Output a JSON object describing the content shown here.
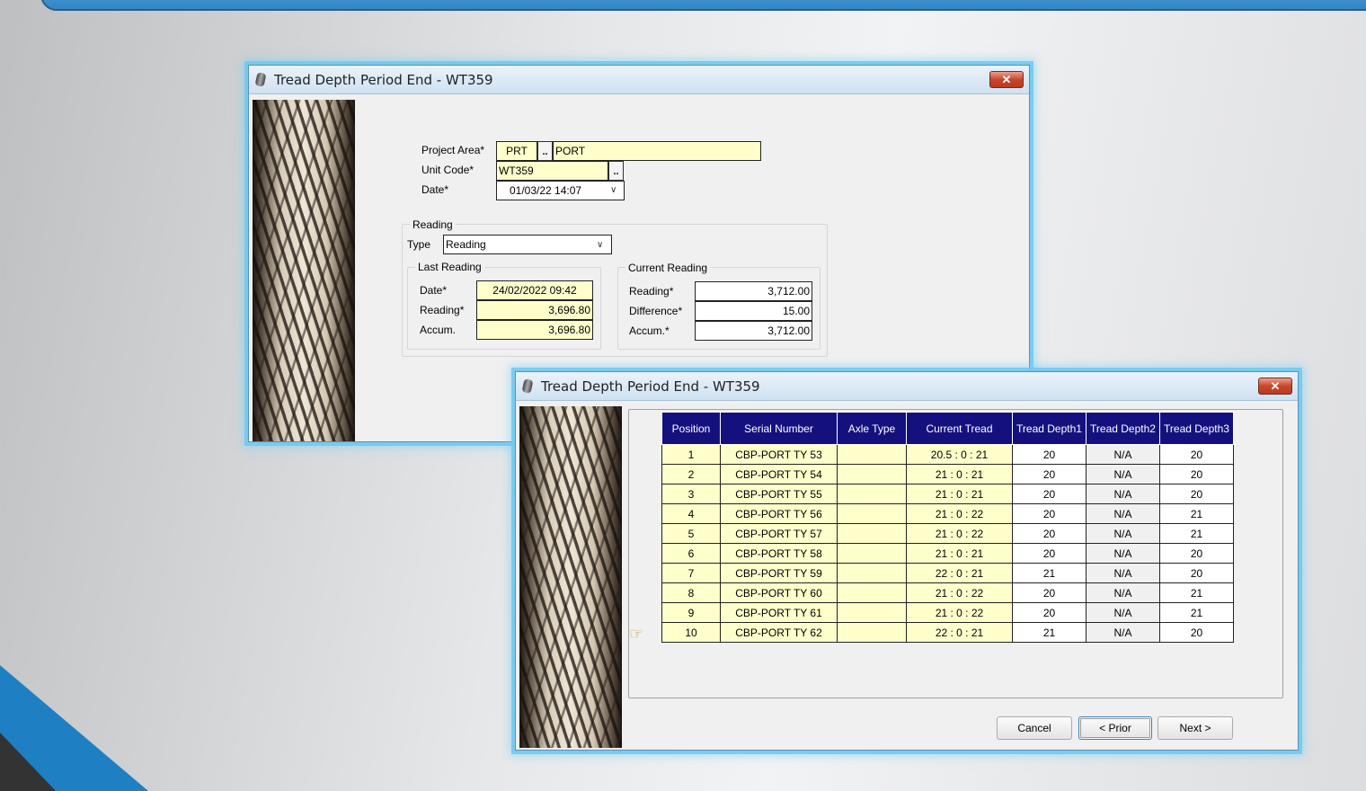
{
  "window1": {
    "title": "Tread Depth Period End - WT359",
    "close_label": "✕",
    "project_area": {
      "label": "Project Area*",
      "code": "PRT",
      "name": "PORT",
      "lookup_label": ".."
    },
    "unit_code": {
      "label": "Unit Code*",
      "value": "WT359",
      "lookup_label": ".."
    },
    "date": {
      "label": "Date*",
      "value": "01/03/22 14:07"
    },
    "reading_group": {
      "title": "Reading",
      "type_label": "Type",
      "type_value": "Reading",
      "last_reading": {
        "title": "Last Reading",
        "date_label": "Date*",
        "date_value": "24/02/2022 09:42",
        "reading_label": "Reading*",
        "reading_value": "3,696.80",
        "accum_label": "Accum.",
        "accum_value": "3,696.80"
      },
      "current_reading": {
        "title": "Current Reading",
        "reading_label": "Reading*",
        "reading_value": "3,712.00",
        "difference_label": "Difference*",
        "difference_value": "15.00",
        "accum_label": "Accum.*",
        "accum_value": "3,712.00"
      }
    }
  },
  "window2": {
    "title": "Tread Depth Period End - WT359",
    "close_label": "✕",
    "columns": [
      "Position",
      "Serial Number",
      "Axle Type",
      "Current Tread",
      "Tread Depth1",
      "Tread Depth2",
      "Tread Depth3"
    ],
    "rows": [
      {
        "position": "1",
        "serial": "CBP-PORT TY 53",
        "axle": "",
        "current": "20.5  :  0  :  21",
        "d1": "20",
        "d2": "N/A",
        "d3": "20"
      },
      {
        "position": "2",
        "serial": "CBP-PORT TY 54",
        "axle": "",
        "current": "21  :  0  :  21",
        "d1": "20",
        "d2": "N/A",
        "d3": "20"
      },
      {
        "position": "3",
        "serial": "CBP-PORT TY 55",
        "axle": "",
        "current": "21  :  0  :  21",
        "d1": "20",
        "d2": "N/A",
        "d3": "20"
      },
      {
        "position": "4",
        "serial": "CBP-PORT TY 56",
        "axle": "",
        "current": "21  :  0  :  22",
        "d1": "20",
        "d2": "N/A",
        "d3": "21"
      },
      {
        "position": "5",
        "serial": "CBP-PORT TY 57",
        "axle": "",
        "current": "21  :  0  :  22",
        "d1": "20",
        "d2": "N/A",
        "d3": "21"
      },
      {
        "position": "6",
        "serial": "CBP-PORT TY 58",
        "axle": "",
        "current": "21  :  0  :  21",
        "d1": "20",
        "d2": "N/A",
        "d3": "20"
      },
      {
        "position": "7",
        "serial": "CBP-PORT TY 59",
        "axle": "",
        "current": "22  :  0  :  21",
        "d1": "21",
        "d2": "N/A",
        "d3": "20"
      },
      {
        "position": "8",
        "serial": "CBP-PORT TY 60",
        "axle": "",
        "current": "21  :  0  :  22",
        "d1": "20",
        "d2": "N/A",
        "d3": "21"
      },
      {
        "position": "9",
        "serial": "CBP-PORT TY 61",
        "axle": "",
        "current": "21  :  0  :  22",
        "d1": "20",
        "d2": "N/A",
        "d3": "21"
      },
      {
        "position": "10",
        "serial": "CBP-PORT TY 62",
        "axle": "",
        "current": "22  :  0  :  21",
        "d1": "21",
        "d2": "N/A",
        "d3": "20"
      }
    ],
    "buttons": {
      "cancel": "Cancel",
      "prior": "< Prior",
      "next": "Next >"
    }
  },
  "colors": {
    "accent_blue": "#14117f",
    "field_yellow": "#ffffcc",
    "glow": "#6ec8f0",
    "slide_blue": "#1e7fc2"
  },
  "icons": [
    "tyre-icon",
    "close-icon",
    "chevron-down-icon",
    "pointing-hand-icon"
  ]
}
